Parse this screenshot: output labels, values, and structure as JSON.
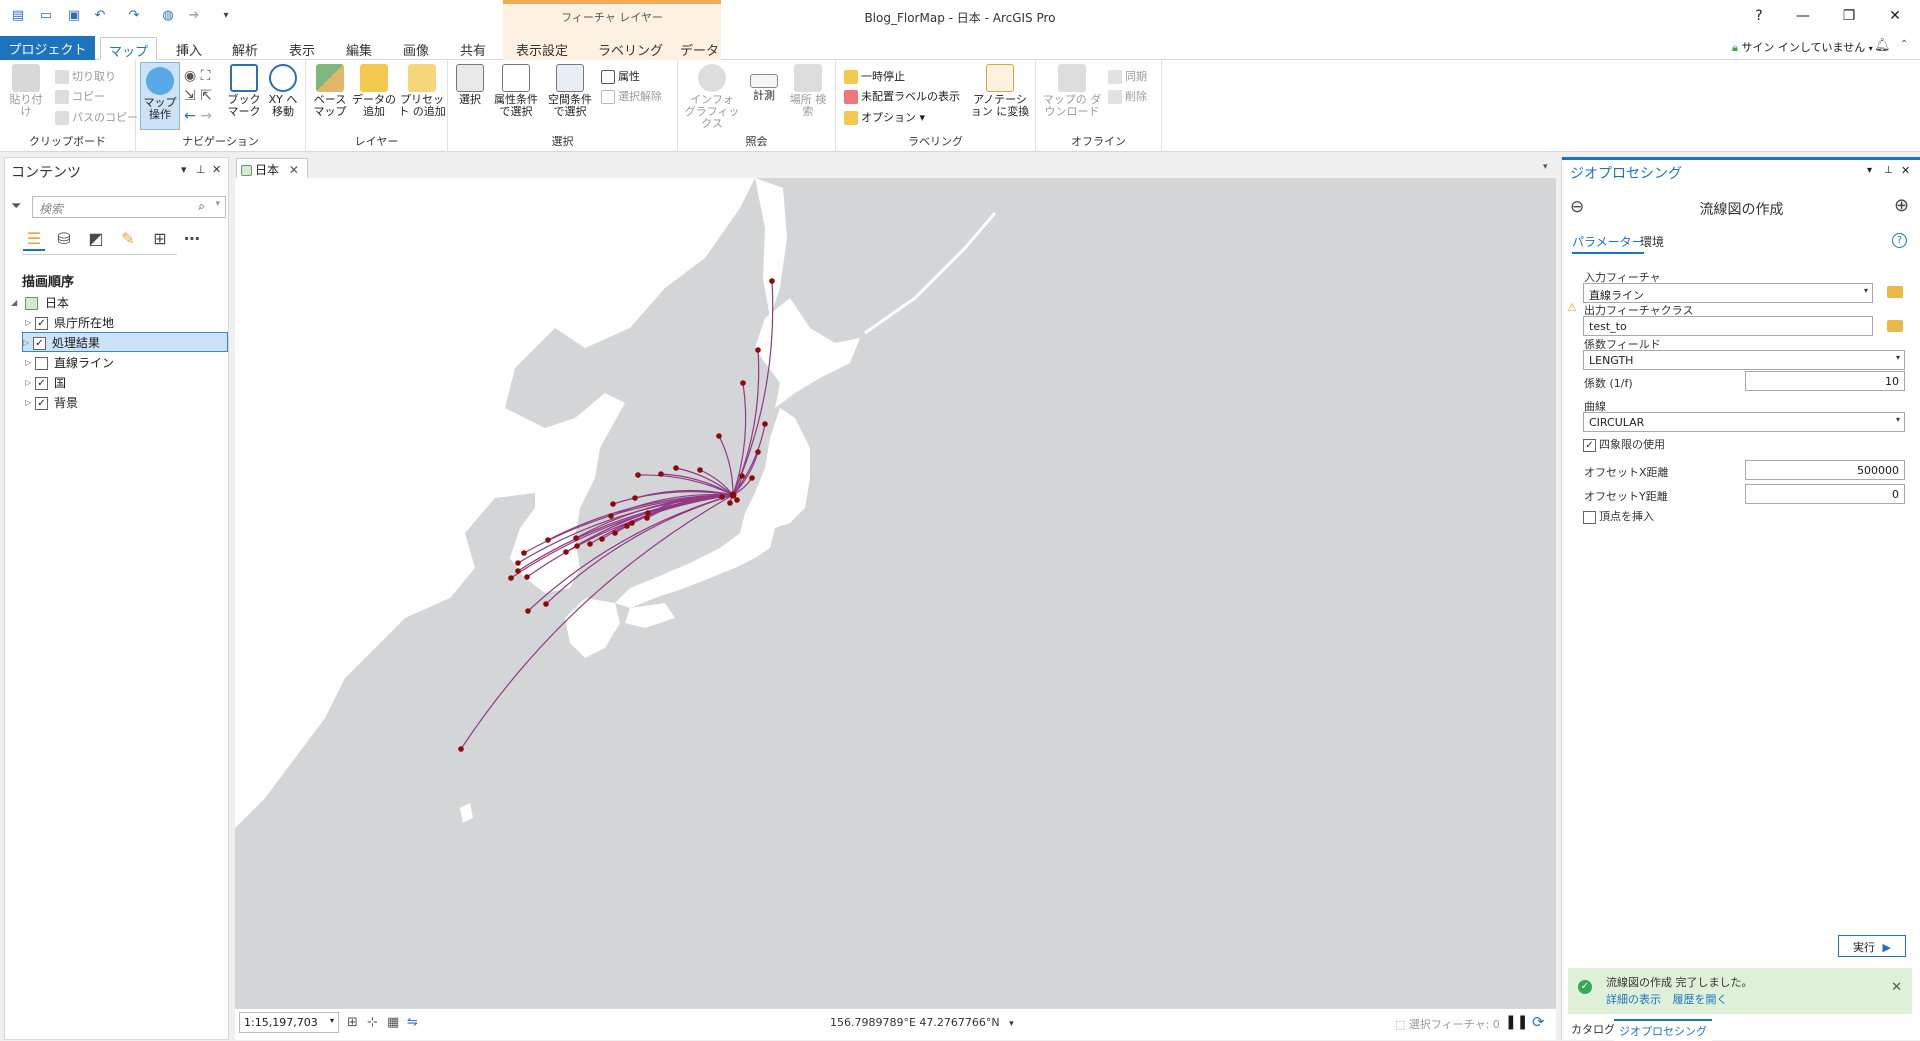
{
  "window": {
    "title": "Blog_FlorMap - 日本 - ArcGIS Pro",
    "context_header": "フィーチャ レイヤー",
    "help": "?",
    "minimize": "—",
    "restore": "❐",
    "close": "✕",
    "signin": "サイン インしていません",
    "notification_icon": "bell-icon"
  },
  "tabs": {
    "project": "プロジェクト",
    "map": "マップ",
    "insert": "挿入",
    "analysis": "解析",
    "view": "表示",
    "edit": "編集",
    "imagery": "画像",
    "share": "共有",
    "appearance": "表示設定",
    "labeling": "ラベリング",
    "data": "データ"
  },
  "ribbon": {
    "clipboard": {
      "label": "クリップボード",
      "paste": "貼り付け",
      "cut": "切り取り",
      "copy": "コピー",
      "copy_path": "パスのコピー"
    },
    "navigation": {
      "label": "ナビゲーション",
      "explore": "マップ 操作",
      "bookmarks": "ブック マーク",
      "goto_xy": "XY へ移動"
    },
    "layer": {
      "label": "レイヤー",
      "basemap": "ベース マップ",
      "add_data": "データの 追加",
      "add_preset": "プリセット の追加"
    },
    "selection": {
      "label": "選択",
      "select": "選択",
      "by_attributes": "属性条件 で選択",
      "by_location": "空間条件 で選択",
      "attributes": "属性",
      "clear": "選択解除"
    },
    "inquiry": {
      "label": "照会",
      "infographics": "インフォ グラフィックス",
      "measure": "計測",
      "locate": "場所 検索"
    },
    "labeling": {
      "label": "ラベリング",
      "pause": "一時停止",
      "unplaced": "未配置ラベルの表示",
      "options": "オプション",
      "convert": "アノテーション に変換"
    },
    "offline": {
      "label": "オフライン",
      "download": "マップの ダウンロード",
      "sync": "同期",
      "remove": "削除"
    }
  },
  "contents": {
    "title": "コンテンツ",
    "search_placeholder": "検索",
    "draw_order": "描画順序",
    "map_name": "日本",
    "layers": [
      {
        "name": "県庁所在地",
        "checked": "✓"
      },
      {
        "name": "処理結果",
        "checked": "✓"
      },
      {
        "name": "直線ライン",
        "checked": ""
      },
      {
        "name": "国",
        "checked": "✓"
      },
      {
        "name": "背景",
        "checked": "✓"
      }
    ]
  },
  "map": {
    "tab_label": "日本",
    "scale": "1:15,197,703",
    "coords": "156.7989789°E 47.2767766°N",
    "selected_features": "選択フィーチャ: 0",
    "colors": {
      "land": "#ffffff",
      "sea": "#d4d5d6",
      "flow": "#8e3a85",
      "point": "#8b0a0a"
    }
  },
  "geoprocessing": {
    "title": "ジオプロセシング",
    "tool_title": "流線図の作成",
    "tab_params": "パラメーター",
    "tab_env": "環境",
    "input_label": "入力フィーチャ",
    "input_value": "直線ライン",
    "output_label": "出力フィーチャクラス",
    "output_value": "test_to",
    "coef_field_label": "係数フィールド",
    "coef_field_value": "LENGTH",
    "coef_label": "係数 (1/f)",
    "coef_value": "10",
    "curve_label": "曲線",
    "curve_value": "CIRCULAR",
    "quadrant_label": "四象限の使用",
    "offset_x_label": "オフセットX距離",
    "offset_x_value": "500000",
    "offset_y_label": "オフセットY距離",
    "offset_y_value": "0",
    "vertex_label": "頂点を挿入",
    "run": "実行",
    "msg_main": "流線図の作成 完了しました。",
    "msg_details": "詳細の表示",
    "msg_history": "履歴を開く",
    "bottom_tab_catalog": "カタログ",
    "bottom_tab_gp": "ジオプロセシング"
  }
}
